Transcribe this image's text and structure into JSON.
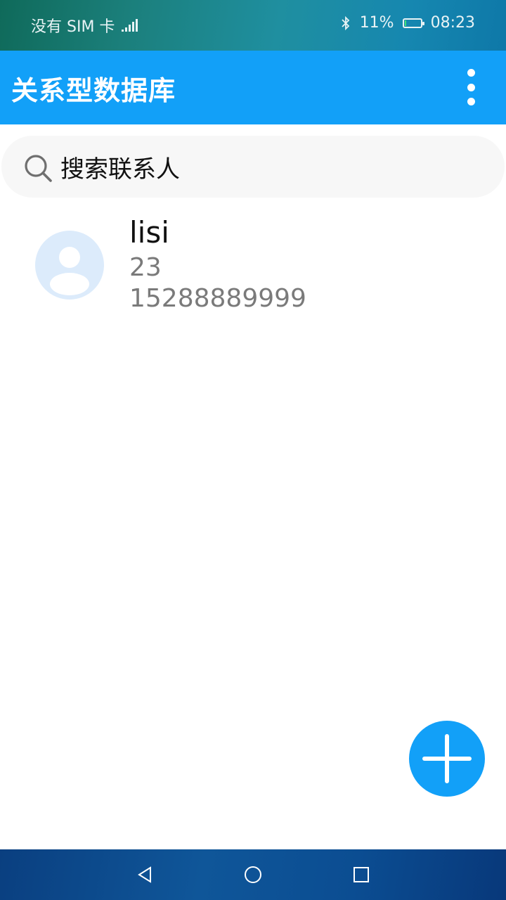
{
  "status_bar": {
    "carrier": "没有 SIM 卡",
    "battery_percent": "11%",
    "battery_level": 0.11,
    "time": "08:23",
    "icons": [
      "signal-icon",
      "bluetooth-icon",
      "battery-icon"
    ]
  },
  "app_bar": {
    "title": "关系型数据库",
    "menu_icon": "more-vertical-icon"
  },
  "search": {
    "placeholder": "搜索联系人",
    "icon": "search-icon"
  },
  "contacts": [
    {
      "name": "lisi",
      "age": "23",
      "phone": "15288889999",
      "avatar_icon": "person-icon"
    }
  ],
  "fab": {
    "icon": "plus-icon"
  },
  "nav_bar": {
    "icons": [
      "back-icon",
      "home-icon",
      "recents-icon"
    ]
  },
  "colors": {
    "primary": "#12a0f8",
    "avatar_bg": "#dcebfb",
    "secondary_text": "#7a7a7a"
  }
}
